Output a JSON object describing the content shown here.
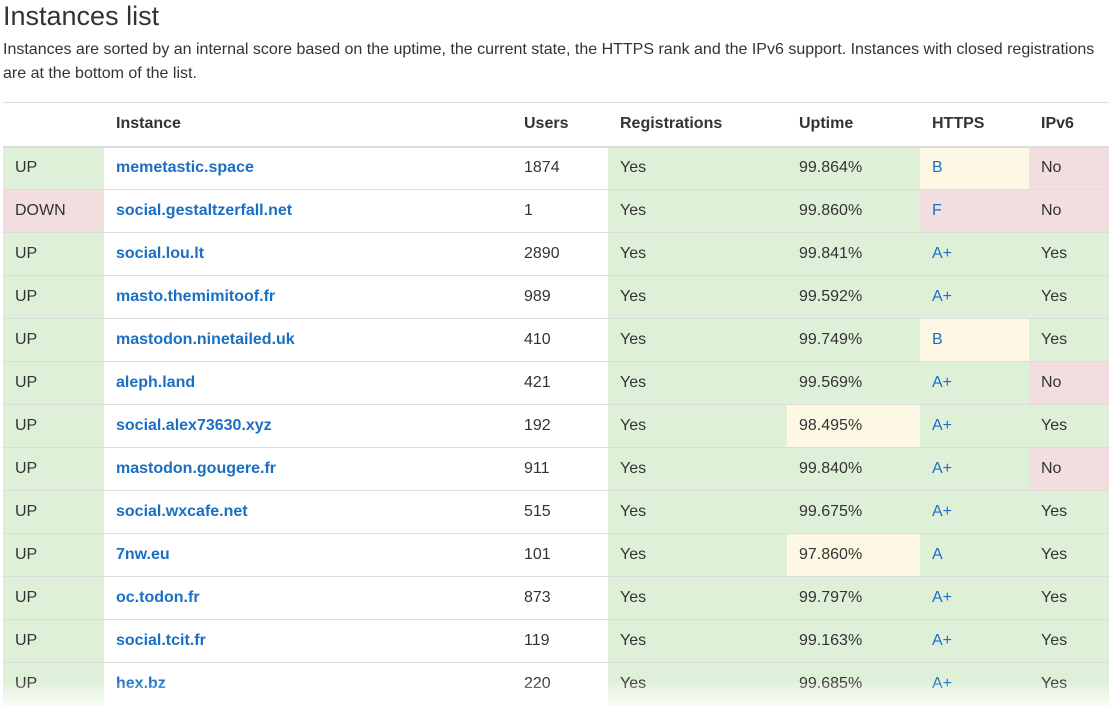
{
  "page": {
    "title": "Instances list",
    "description": "Instances are sorted by an internal score based on the uptime, the current state, the HTTPS rank and the IPv6 support. Instances with closed registrations are at the bottom of the list."
  },
  "colors": {
    "good": "#dff0d8",
    "bad": "#f2dede",
    "warn": "#fcf8e3",
    "link": "#1a6fc4"
  },
  "table": {
    "headers": [
      "",
      "Instance",
      "Users",
      "Registrations",
      "Uptime",
      "HTTPS",
      "IPv6"
    ],
    "rows": [
      {
        "status": "UP",
        "instance": "memetastic.space",
        "users": "1874",
        "registrations": "Yes",
        "uptime": "99.864%",
        "https": "B",
        "ipv6": "No",
        "status_class": "ok",
        "users_class": "plain",
        "reg_class": "ok",
        "uptime_class": "ok",
        "https_class": "warn",
        "ipv6_class": "bad"
      },
      {
        "status": "DOWN",
        "instance": "social.gestaltzerfall.net",
        "users": "1",
        "registrations": "Yes",
        "uptime": "99.860%",
        "https": "F",
        "ipv6": "No",
        "status_class": "bad",
        "users_class": "plain",
        "reg_class": "ok",
        "uptime_class": "ok",
        "https_class": "bad",
        "ipv6_class": "bad"
      },
      {
        "status": "UP",
        "instance": "social.lou.lt",
        "users": "2890",
        "registrations": "Yes",
        "uptime": "99.841%",
        "https": "A+",
        "ipv6": "Yes",
        "status_class": "ok",
        "users_class": "plain",
        "reg_class": "ok",
        "uptime_class": "ok",
        "https_class": "ok",
        "ipv6_class": "ok"
      },
      {
        "status": "UP",
        "instance": "masto.themimitoof.fr",
        "users": "989",
        "registrations": "Yes",
        "uptime": "99.592%",
        "https": "A+",
        "ipv6": "Yes",
        "status_class": "ok",
        "users_class": "plain",
        "reg_class": "ok",
        "uptime_class": "ok",
        "https_class": "ok",
        "ipv6_class": "ok"
      },
      {
        "status": "UP",
        "instance": "mastodon.ninetailed.uk",
        "users": "410",
        "registrations": "Yes",
        "uptime": "99.749%",
        "https": "B",
        "ipv6": "Yes",
        "status_class": "ok",
        "users_class": "plain",
        "reg_class": "ok",
        "uptime_class": "ok",
        "https_class": "warn",
        "ipv6_class": "ok"
      },
      {
        "status": "UP",
        "instance": "aleph.land",
        "users": "421",
        "registrations": "Yes",
        "uptime": "99.569%",
        "https": "A+",
        "ipv6": "No",
        "status_class": "ok",
        "users_class": "plain",
        "reg_class": "ok",
        "uptime_class": "ok",
        "https_class": "ok",
        "ipv6_class": "bad"
      },
      {
        "status": "UP",
        "instance": "social.alex73630.xyz",
        "users": "192",
        "registrations": "Yes",
        "uptime": "98.495%",
        "https": "A+",
        "ipv6": "Yes",
        "status_class": "ok",
        "users_class": "plain",
        "reg_class": "ok",
        "uptime_class": "warn",
        "https_class": "ok",
        "ipv6_class": "ok"
      },
      {
        "status": "UP",
        "instance": "mastodon.gougere.fr",
        "users": "911",
        "registrations": "Yes",
        "uptime": "99.840%",
        "https": "A+",
        "ipv6": "No",
        "status_class": "ok",
        "users_class": "plain",
        "reg_class": "ok",
        "uptime_class": "ok",
        "https_class": "ok",
        "ipv6_class": "bad"
      },
      {
        "status": "UP",
        "instance": "social.wxcafe.net",
        "users": "515",
        "registrations": "Yes",
        "uptime": "99.675%",
        "https": "A+",
        "ipv6": "Yes",
        "status_class": "ok",
        "users_class": "plain",
        "reg_class": "ok",
        "uptime_class": "ok",
        "https_class": "ok",
        "ipv6_class": "ok"
      },
      {
        "status": "UP",
        "instance": "7nw.eu",
        "users": "101",
        "registrations": "Yes",
        "uptime": "97.860%",
        "https": "A",
        "ipv6": "Yes",
        "status_class": "ok",
        "users_class": "plain",
        "reg_class": "ok",
        "uptime_class": "warn",
        "https_class": "ok",
        "ipv6_class": "ok"
      },
      {
        "status": "UP",
        "instance": "oc.todon.fr",
        "users": "873",
        "registrations": "Yes",
        "uptime": "99.797%",
        "https": "A+",
        "ipv6": "Yes",
        "status_class": "ok",
        "users_class": "plain",
        "reg_class": "ok",
        "uptime_class": "ok",
        "https_class": "ok",
        "ipv6_class": "ok"
      },
      {
        "status": "UP",
        "instance": "social.tcit.fr",
        "users": "119",
        "registrations": "Yes",
        "uptime": "99.163%",
        "https": "A+",
        "ipv6": "Yes",
        "status_class": "ok",
        "users_class": "plain",
        "reg_class": "ok",
        "uptime_class": "ok",
        "https_class": "ok",
        "ipv6_class": "ok"
      },
      {
        "status": "UP",
        "instance": "hex.bz",
        "users": "220",
        "registrations": "Yes",
        "uptime": "99.685%",
        "https": "A+",
        "ipv6": "Yes",
        "status_class": "ok",
        "users_class": "plain",
        "reg_class": "ok",
        "uptime_class": "ok",
        "https_class": "ok",
        "ipv6_class": "ok"
      }
    ]
  }
}
